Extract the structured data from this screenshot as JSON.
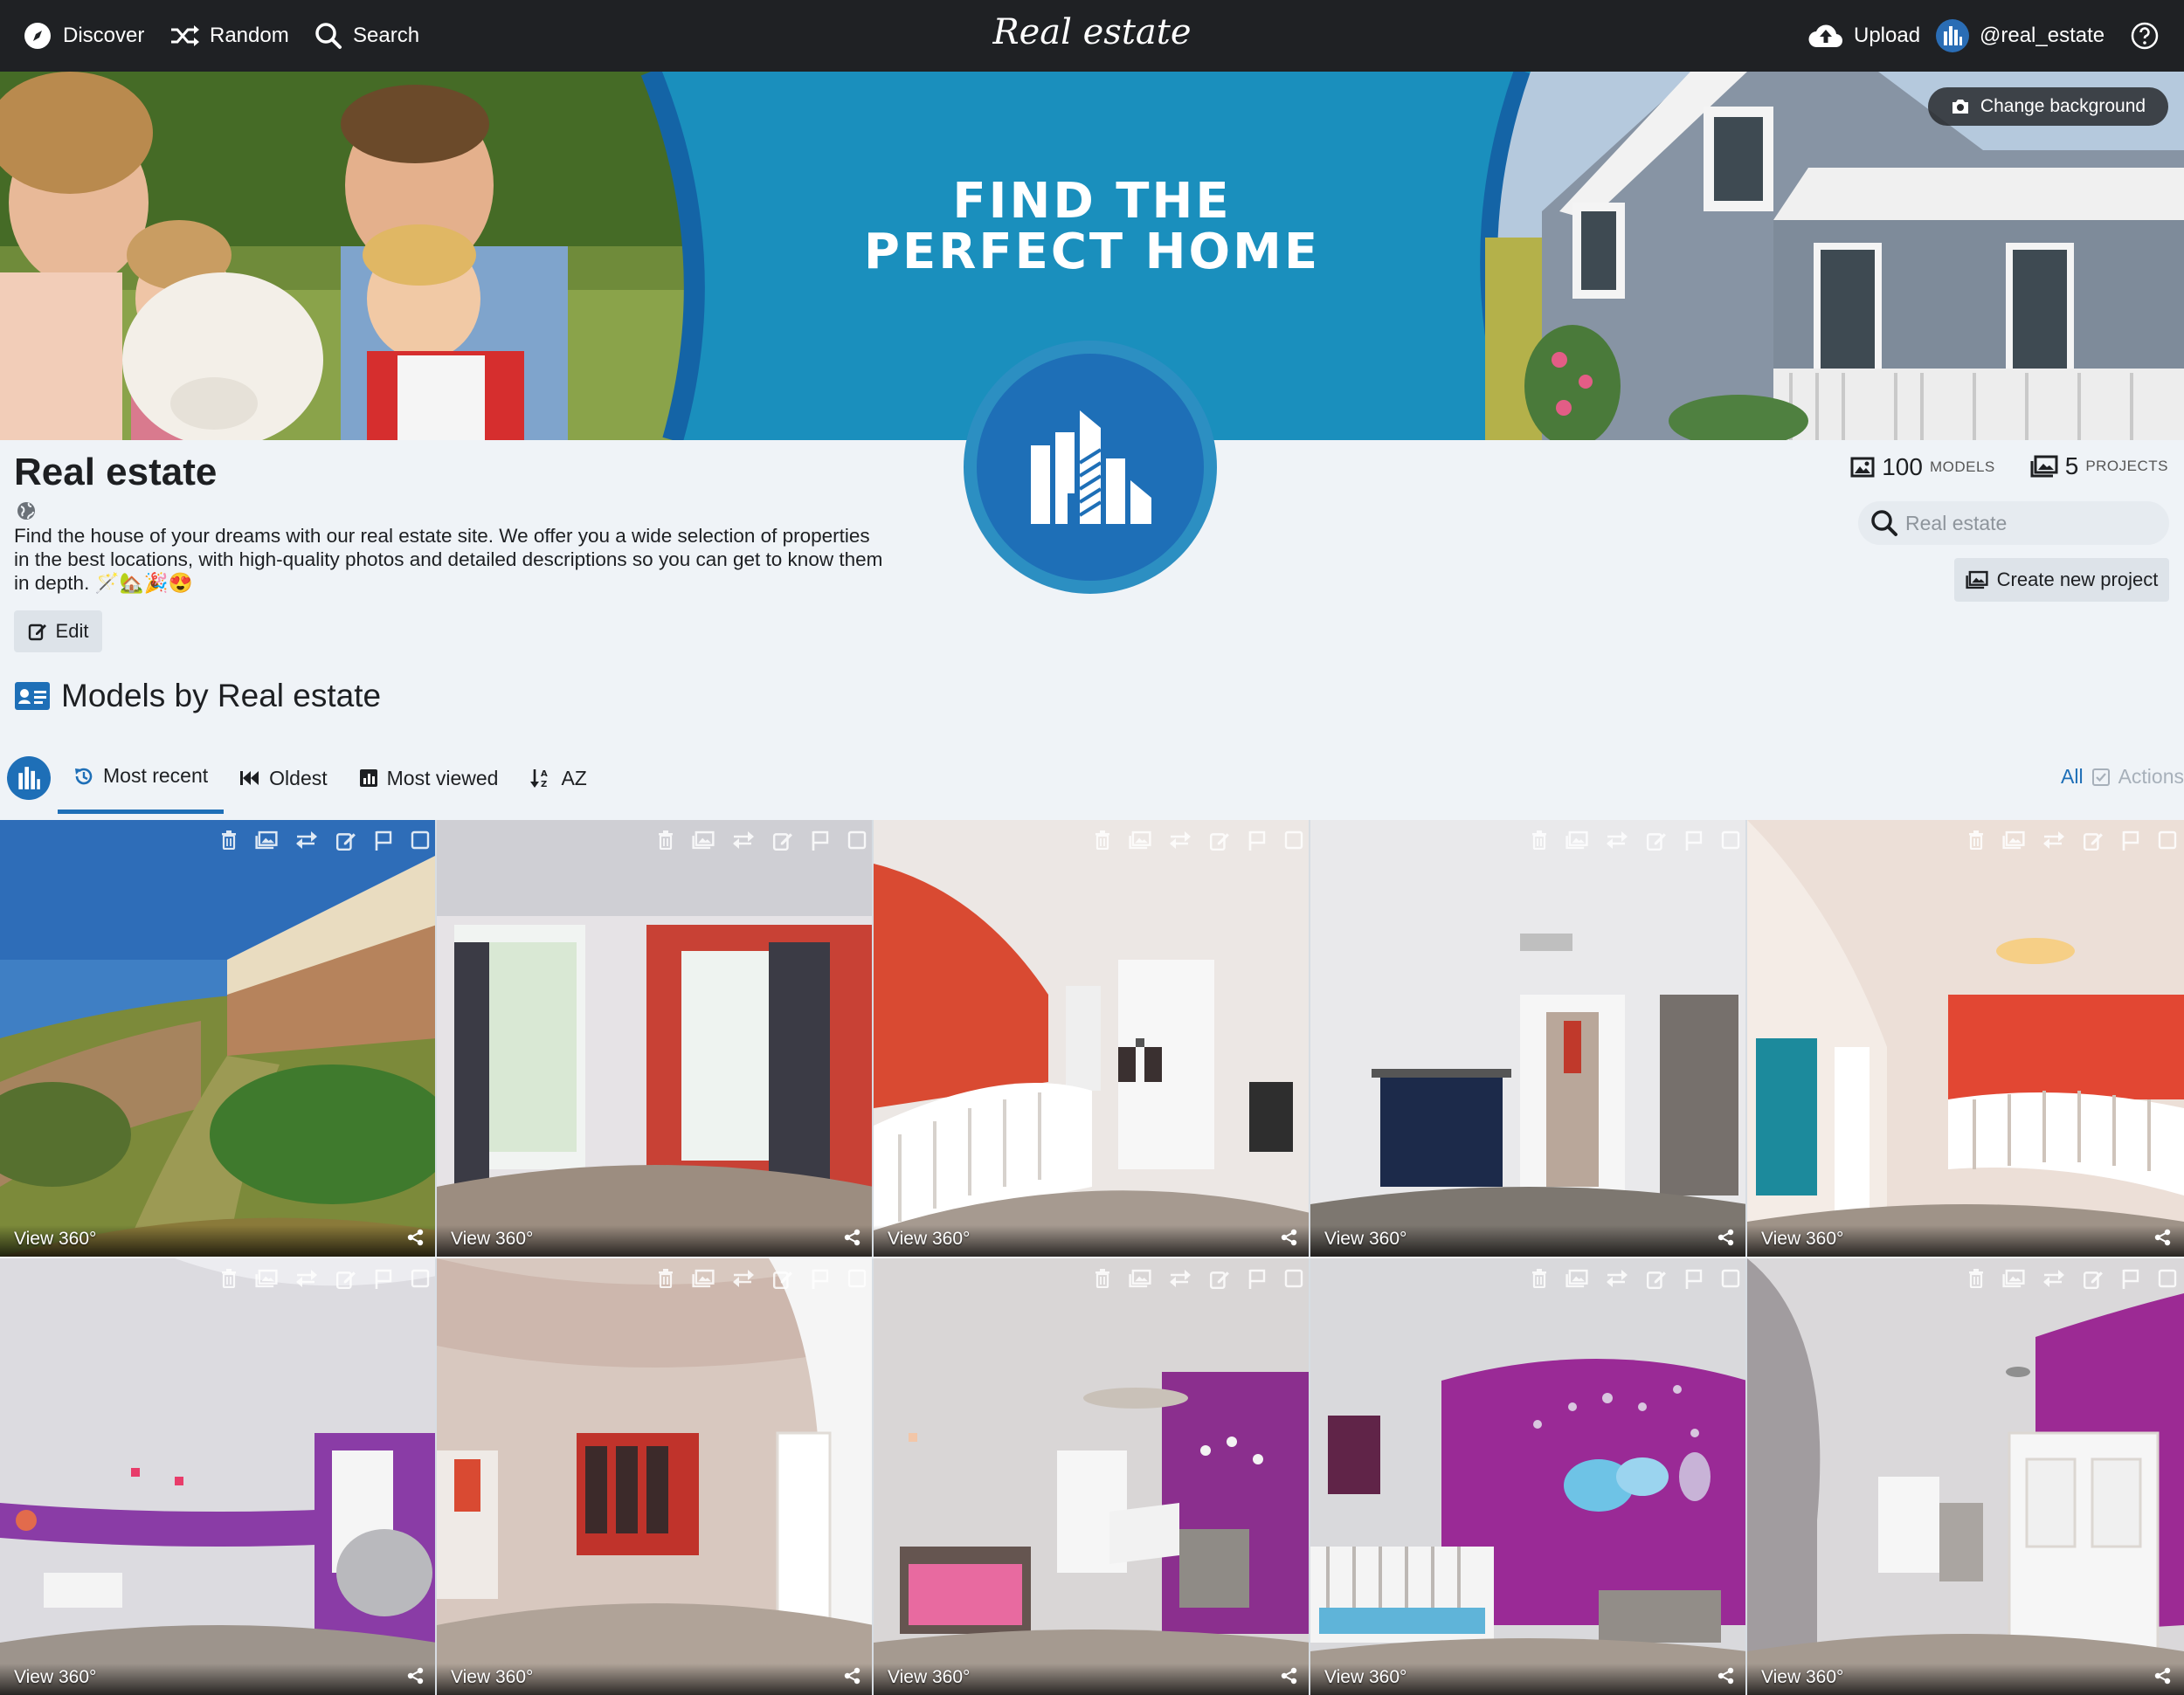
{
  "topbar": {
    "discover": "Discover",
    "random": "Random",
    "search": "Search",
    "brand": "Real estate",
    "upload": "Upload",
    "username": "@real_estate"
  },
  "banner": {
    "headline_line1": "FIND THE",
    "headline_line2": "PERFECT HOME",
    "change_background": "Change background"
  },
  "profile": {
    "name": "Real estate",
    "description": "Find the house of your dreams with our real estate site. We offer you a wide selection of properties in the best locations, with high-quality photos and detailed descriptions so you can get to know them in depth. 🪄🏡🎉😍",
    "edit_label": "Edit",
    "models_count": "100",
    "models_unit": "MODELS",
    "projects_count": "5",
    "projects_unit": "PROJECTS",
    "search_placeholder": "Real estate",
    "create_project": "Create new project"
  },
  "models_section": {
    "title": "Models by Real estate",
    "tabs": [
      {
        "label": "Most recent",
        "active": true
      },
      {
        "label": "Oldest",
        "active": false
      },
      {
        "label": "Most viewed",
        "active": false
      },
      {
        "label": "AZ",
        "active": false
      }
    ],
    "select_all": "All",
    "actions": "Actions"
  },
  "cards": [
    {
      "label": "View 360°",
      "scene": "castle-outdoor"
    },
    {
      "label": "View 360°",
      "scene": "window-curtains"
    },
    {
      "label": "View 360°",
      "scene": "hallway-red"
    },
    {
      "label": "View 360°",
      "scene": "bathroom-doorway"
    },
    {
      "label": "View 360°",
      "scene": "loft-stairs"
    },
    {
      "label": "View 360°",
      "scene": "nursery-purple"
    },
    {
      "label": "View 360°",
      "scene": "bedroom-red-wall"
    },
    {
      "label": "View 360°",
      "scene": "nursery-crib"
    },
    {
      "label": "View 360°",
      "scene": "nursery-stars"
    },
    {
      "label": "View 360°",
      "scene": "nursery-door"
    }
  ],
  "colors": {
    "topbar": "#1f2124",
    "accent": "#1e6fb7",
    "page_bg": "#eff3f7",
    "banner_blue": "#1a8fbd"
  }
}
